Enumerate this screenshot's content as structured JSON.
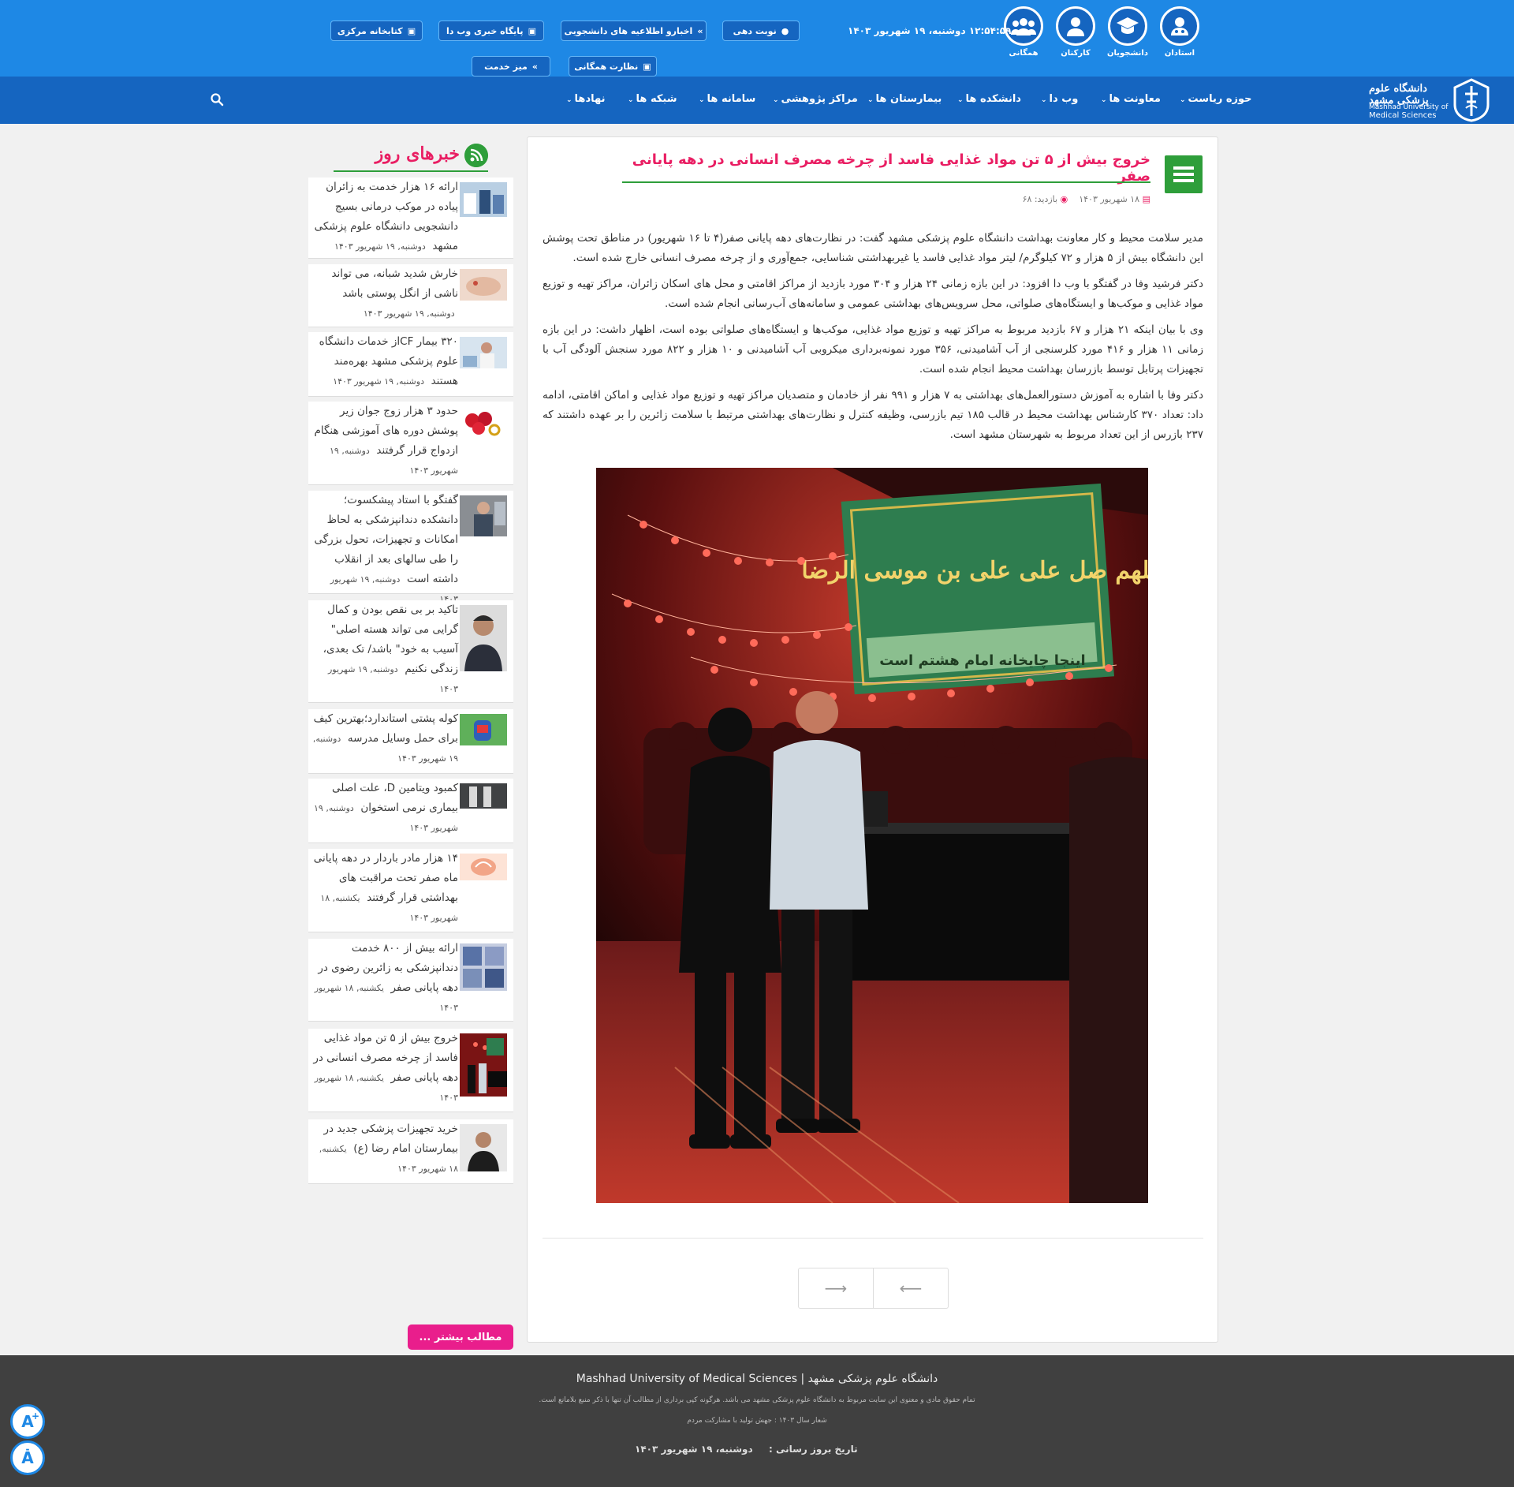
{
  "header": {
    "roles": [
      {
        "label": "استادان",
        "icon": "teacher-icon"
      },
      {
        "label": "دانشجویان",
        "icon": "graduate-icon"
      },
      {
        "label": "کارکنان",
        "icon": "staff-icon"
      },
      {
        "label": "همگانی",
        "icon": "public-icon"
      }
    ],
    "datetime": "۱۲:۵۴:۵۹ دوشنبه، ۱۹ شهریور ۱۴۰۳",
    "quick_links": {
      "appointment": "نوبت دهی",
      "student_news": "اخبارو اطلاعیه های دانشجویی",
      "webda": "پایگاه خبری وب دا",
      "library": "کتابخانه مرکزی",
      "public_monitoring": "نظارت همگانی",
      "service_desk": "میز خدمت"
    }
  },
  "nav": {
    "logo_fa": "دانشگاه علوم پزشکی مشهد",
    "logo_en_1": "Mashhad University of",
    "logo_en_2": "Medical Sciences",
    "items": [
      "حوزه ریاست",
      "معاونت ها",
      "وب دا",
      "دانشکده ها",
      "بیمارستان ها",
      "مراکز پژوهشی",
      "سامانه ها",
      "شبکه ها",
      "نهادها"
    ]
  },
  "article": {
    "title": "خروج بیش از ۵ تن مواد غذایی فاسد از چرخه مصرف انسانی در دهه پایانی صفر",
    "date": "۱۸ شهریور ۱۴۰۳",
    "views": "بازدید: ۶۸",
    "paragraphs": [
      "مدیر سلامت محیط و کار معاونت بهداشت دانشگاه علوم پزشکی مشهد گفت: در نظارت‌های دهه پایانی صفر(۴ تا ۱۶ شهریور) در مناطق تحت پوشش این دانشگاه بیش از ۵ هزار و ۷۲ کیلوگرم/ لیتر مواد غذایی فاسد یا غیربهداشتی شناسایی، جمع‌آوری و از چرخه مصرف انسانی خارج شده است.",
      "دکتر فرشید وفا در گفتگو با وب دا  افزود: در این بازه زمانی ۲۴ هزار و ۳۰۴ مورد بازدید از مراکز اقامتی و محل های اسکان زائران، مراکز تهیه و توزیع مواد غذایی و موکب‌ها و ایستگاه‌های صلواتی، محل سرویس‌های بهداشتی عمومی و سامانه‌های آب‌رسانی انجام شده است.",
      "وی با بیان اینکه ۲۱ هزار و ۶۷ بازدید مربوط به مراکز تهیه و توزیع مواد غذایی، موکب‌ها و ایستگاه‌های صلواتی بوده است، اظهار داشت: در این بازه زمانی ۱۱ هزار و ۴۱۶ مورد کلرسنجی از آب آشامیدنی، ۳۵۶ مورد نمونه‌برداری میکروبی آب آشامیدنی و ۱۰ هزار و ۸۲۲ مورد سنجش آلودگی آب با  تجهیزات پرتابل توسط بازرسان بهداشت محیط انجام شده است.",
      "دکتر وفا با اشاره به آموزش دستورالعمل‌های بهداشتی به ۷ هزار و ۹۹۱ نفر از خادمان و متصدیان مراکز تهیه و توزیع مواد غذایی و اماکن اقامتی، ادامه داد: تعداد ۳۷۰ کارشناس بهداشت محیط در قالب ۱۸۵ تیم بازرسی، وظیفه  کنترل و نظارت‌های بهداشتی مرتبط با سلامت زائرین را بر عهده داشتند که ۲۳۷ بازرس از این تعداد مربوط به شهرستان مشهد است."
    ],
    "banner_line1": "اللهم صل علی علی بن موسی الرضا",
    "banner_line2": "اینجا چایخانه امام هشتم است"
  },
  "sidebar": {
    "title": "خبرهای روز",
    "more": "مطالب بیشتر ...",
    "news": [
      {
        "title": "ارائه ۱۶ هزار خدمت به زائران پیاده در موکب درمانی بسیج دانشجویی دانشگاه علوم پزشکی مشهد",
        "date": "دوشنبه, ۱۹ شهریور ۱۴۰۳"
      },
      {
        "title": "خارش شدید شبانه، می تواند ناشی از انگل پوستی باشد",
        "date": "دوشنبه, ۱۹ شهریور ۱۴۰۳"
      },
      {
        "title": "۳۲۰ بیمار CFاز خدمات دانشگاه علوم پزشکی مشهد بهره‌مند هستند",
        "date": "دوشنبه, ۱۹ شهریور ۱۴۰۳"
      },
      {
        "title": "حدود ۳ هزار زوج جوان زیر پوشش دوره های آموزشی هنگام ازدواج قرار گرفتند",
        "date": "دوشنبه, ۱۹ شهریور ۱۴۰۳"
      },
      {
        "title": "گفتگو با استاد پیشکسوت؛ دانشکده دندانپزشکی به لحاظ امکانات و تجهیزات، تحول بزرگی را طی سالهای بعد از انقلاب داشته است",
        "date": "دوشنبه, ۱۹ شهریور ۱۴۰۳"
      },
      {
        "title": "تاکید بر بی نقص بودن و کمال گرایی می تواند هسته اصلی\" آسیب به خود\" باشد/ تک بعدی، زندگی نکنیم",
        "date": "دوشنبه, ۱۹ شهریور ۱۴۰۳"
      },
      {
        "title": "کوله پشتی استاندارد؛بهترین کیف برای حمل وسایل مدرسه",
        "date": "دوشنبه, ۱۹ شهریور ۱۴۰۳"
      },
      {
        "title": "کمبود ویتامین D، علت اصلی بیماری نرمی استخوان",
        "date": "دوشنبه, ۱۹ شهریور ۱۴۰۳"
      },
      {
        "title": "۱۴ هزار مادر باردار در دهه پایانی ماه صفر تحت مراقبت های بهداشتی قرار گرفتند",
        "date": "یکشنبه, ۱۸ شهریور ۱۴۰۳"
      },
      {
        "title": "ارائه بیش از  ۸۰۰ خدمت دندانپزشکی به زائرین رضوی در دهه پایانی صفر",
        "date": "یکشنبه, ۱۸ شهریور ۱۴۰۳"
      },
      {
        "title": "خروج بیش از ۵ تن مواد غذایی فاسد از چرخه مصرف انسانی در دهه پایانی صفر",
        "date": "یکشنبه, ۱۸ شهریور ۱۴۰۳"
      },
      {
        "title": "خرید تجهیزات پزشکی جدید در بیمارستان امام رضا (ع)",
        "date": "یکشنبه, ۱۸ شهریور ۱۴۰۳"
      }
    ]
  },
  "footer": {
    "name": "دانشگاه علوم پزشکی مشهد | Mashhad University of Medical Sciences",
    "rights": "تمام حقوق مادی و معنوی این سایت مربوط به دانشگاه علوم پزشکی مشهد می باشد. هرگونه کپی برداری از مطالب آن تنها با ذکر منبع بلامانع است.",
    "slogan": "شعار سال ۱۴۰۳ : جهش تولید با مشارکت مردم",
    "update_label": "تاریخ بروز رسانی :",
    "update_date": "دوشنبه، ۱۹ شهریور ۱۴۰۳"
  },
  "colors": {
    "primary": "#1e88e5",
    "nav": "#1565c0",
    "accent": "#e91e63",
    "green": "#2e9e3a",
    "footer": "#404040"
  }
}
